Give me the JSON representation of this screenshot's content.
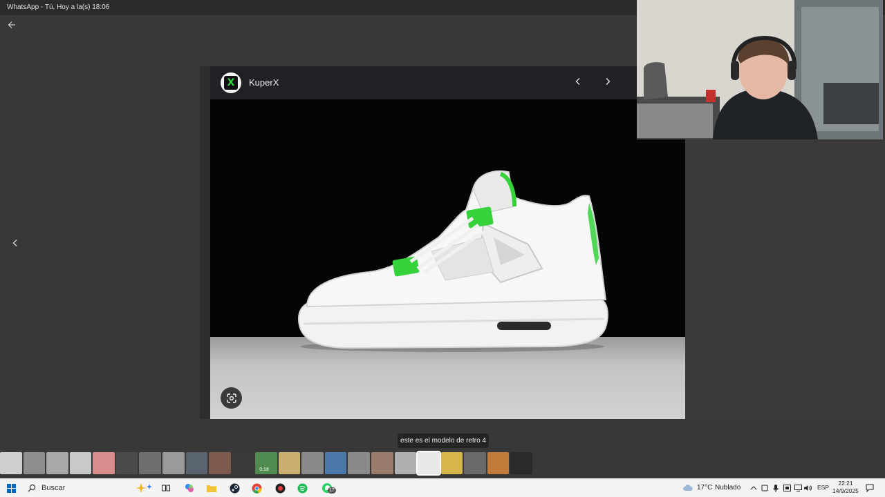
{
  "window": {
    "title": "WhatsApp - Tú, Hoy a la(s) 18:06"
  },
  "viewer": {
    "sender_name": "KuperX",
    "logo_letter": "X",
    "caption": "este es el modelo de retro 4",
    "thumbnail_badge": "0:18",
    "thumbnails_count": 23,
    "active_thumbnail_index": 18
  },
  "icons": {
    "back": "arrow-left-icon",
    "prev": "chevron-left-icon",
    "next": "chevron-right-icon",
    "lens": "google-lens-icon",
    "windows": "windows-start-icon",
    "search": "magnifier-icon"
  },
  "taskbar": {
    "search_placeholder": "Buscar",
    "whatsapp_badge": "17",
    "weather_temp": "17°C",
    "weather_desc": "Nublado",
    "language": "ESP",
    "time": "22:21",
    "date": "14/9/2025"
  },
  "colors": {
    "accent_green": "#35d23b",
    "background": "#383838",
    "taskbar": "#f3f3f3"
  }
}
